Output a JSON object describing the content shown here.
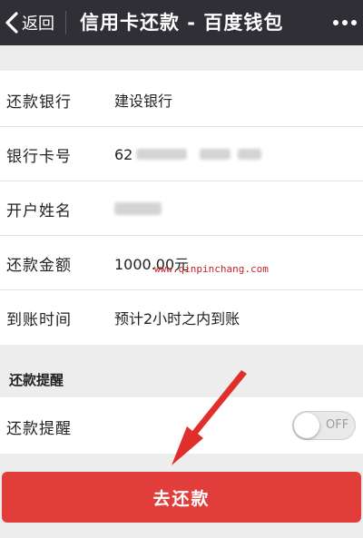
{
  "navbar": {
    "back_label": "返回",
    "title": "信用卡还款 - 百度钱包"
  },
  "details": [
    {
      "label": "还款银行",
      "value": "建设银行"
    },
    {
      "label": "银行卡号",
      "value": "62"
    },
    {
      "label": "开户姓名",
      "value": ""
    },
    {
      "label": "还款金额",
      "value": "1000.00元"
    },
    {
      "label": "到账时间",
      "value": "预计2小时之内到账"
    }
  ],
  "watermark": "www.qinpinchang.com",
  "reminder": {
    "section_title": "还款提醒",
    "row_label": "还款提醒",
    "toggle_text": "OFF",
    "toggle_on": false
  },
  "actions": {
    "pay_label": "去还款"
  },
  "colors": {
    "navbar": "#2f2f35",
    "primary": "#e13e3b",
    "annotation": "#e02f2a"
  },
  "icons": {
    "back": "chevron-left-icon",
    "more": "more-icon"
  }
}
